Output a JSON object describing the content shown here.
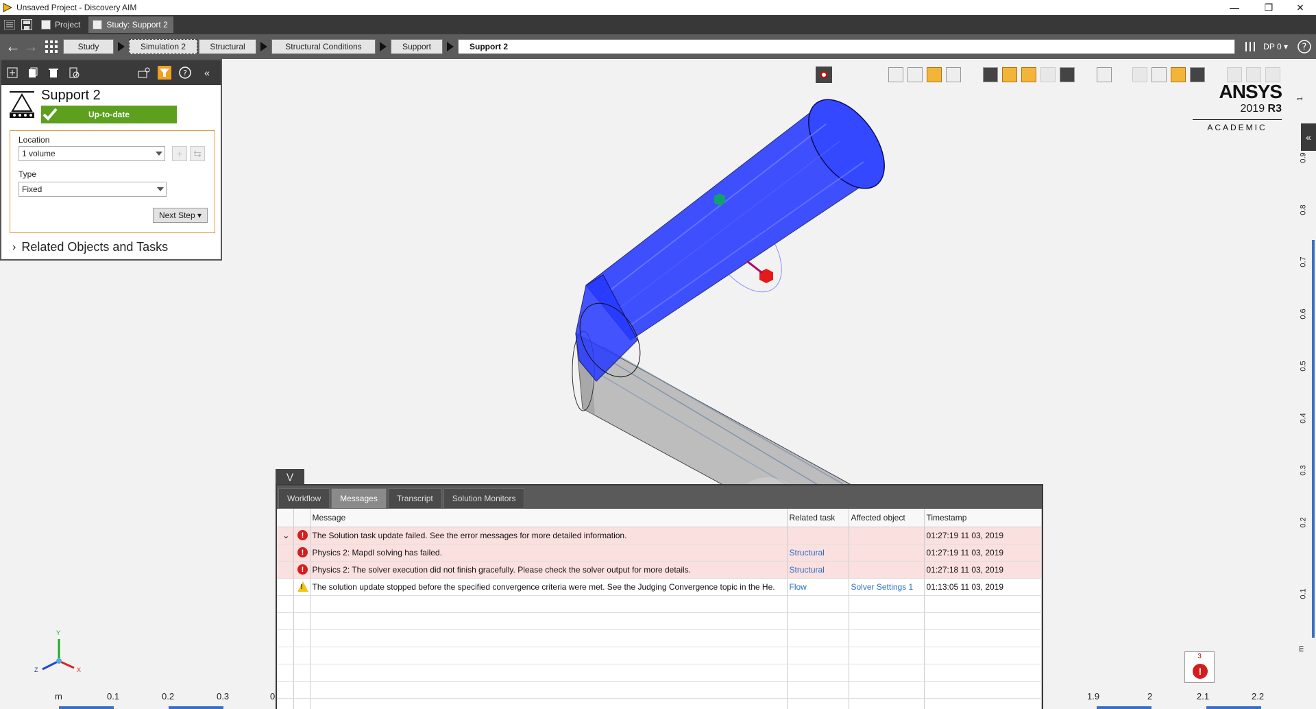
{
  "window": {
    "title": "Unsaved Project - Discovery AIM",
    "minimize": "—",
    "restore": "❐",
    "close": "✕"
  },
  "tabs": [
    {
      "label": "Project",
      "active": false
    },
    {
      "label": "Study: Support 2",
      "active": true
    }
  ],
  "breadcrumb": {
    "items": [
      "Study",
      "Simulation 2",
      "Structural",
      "Structural Conditions",
      "Support"
    ],
    "current": "Support 2",
    "dp_label": "DP 0 ▾"
  },
  "panel": {
    "title": "Support 2",
    "status": "Up-to-date",
    "location_label": "Location",
    "location_value": "1 volume",
    "type_label": "Type",
    "type_value": "Fixed",
    "next_step": "Next Step ▾",
    "related": "Related Objects and Tasks"
  },
  "logo": {
    "brand": "ANSYS",
    "version": "2019",
    "release": "R3",
    "edition": "ACADEMIC"
  },
  "messages": {
    "tabs": [
      "Workflow",
      "Messages",
      "Transcript",
      "Solution Monitors"
    ],
    "active_tab": "Messages",
    "columns": [
      "Message",
      "Related task",
      "Affected object",
      "Timestamp"
    ],
    "rows": [
      {
        "severity": "error",
        "message": "The Solution task update failed. See the error messages for more detailed information.",
        "task": "",
        "object": "",
        "timestamp": "01:27:19 11 03, 2019",
        "expand": "⌄"
      },
      {
        "severity": "error",
        "message": "Physics 2: Mapdl solving has failed.",
        "task": "Structural",
        "object": "",
        "timestamp": "01:27:19 11 03, 2019",
        "expand": ""
      },
      {
        "severity": "error",
        "message": "Physics 2: The solver execution did not finish gracefully. Please check the solver output for more details.",
        "task": "Structural",
        "object": "",
        "timestamp": "01:27:18 11 03, 2019",
        "expand": ""
      },
      {
        "severity": "warning",
        "message": "The solution update stopped before the specified convergence criteria were met. See the Judging Convergence topic in the He.",
        "task": "Flow",
        "object": "Solver Settings 1",
        "timestamp": "01:13:05 11 03, 2019",
        "expand": ""
      }
    ],
    "error_count": "3"
  },
  "ruler": {
    "bottom_unit": "m",
    "bottom_ticks": [
      "0.1",
      "0.2",
      "0.3",
      "0",
      "1.9",
      "2",
      "2.1",
      "2.2"
    ],
    "right_unit": "m",
    "right_ticks": [
      "1",
      "0.9",
      "0.8",
      "0.7",
      "0.6",
      "0.5",
      "0.4",
      "0.3",
      "0.2",
      "0.1"
    ]
  },
  "triad": {
    "x": "X",
    "y": "Y",
    "z": "Z"
  },
  "colors": {
    "status_green": "#5ca01e",
    "pipe_blue": "#1f33ff",
    "pipe_gray": "#b8b8b8",
    "error_red": "#d41e1e",
    "warning_yellow": "#f0c419",
    "link_blue": "#2a6fc0"
  }
}
